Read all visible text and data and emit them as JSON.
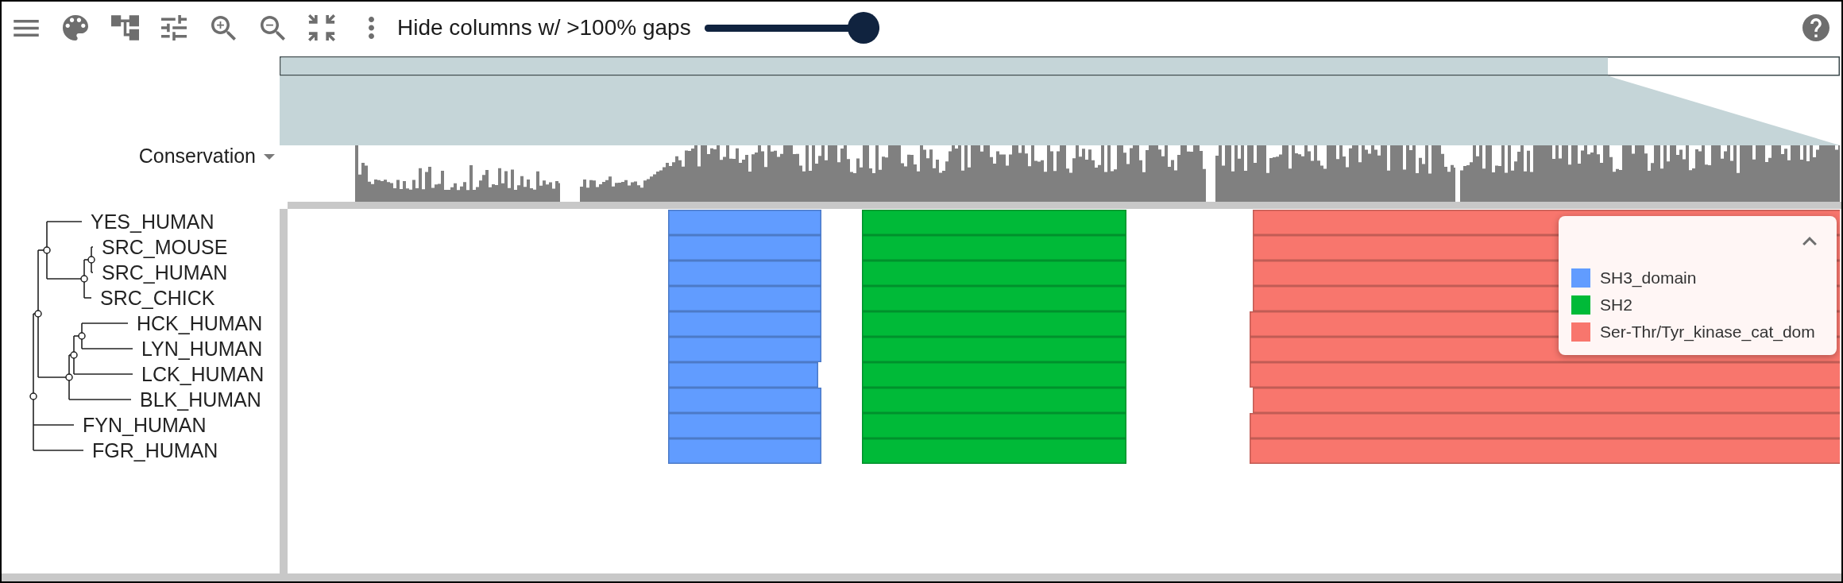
{
  "toolbar": {
    "gap_filter": {
      "label": "Hide columns w/ >100% gaps",
      "level": 1
    }
  },
  "conservation_track": {
    "label": "Conservation"
  },
  "tree": {
    "children": [
      {
        "children": [
          {
            "children": [
              {
                "label": "YES_HUMAN"
              },
              {
                "children": [
                  {
                    "children": [
                      {
                        "label": "SRC_MOUSE"
                      },
                      {
                        "label": "SRC_HUMAN"
                      }
                    ]
                  },
                  {
                    "label": "SRC_CHICK"
                  }
                ]
              }
            ]
          },
          {
            "children": [
              {
                "children": [
                  {
                    "children": [
                      {
                        "label": "HCK_HUMAN"
                      },
                      {
                        "label": "LYN_HUMAN"
                      }
                    ]
                  },
                  {
                    "label": "LCK_HUMAN"
                  }
                ]
              },
              {
                "label": "BLK_HUMAN"
              }
            ]
          }
        ]
      },
      {
        "label": "FYN_HUMAN"
      },
      {
        "label": "FGR_HUMAN"
      }
    ]
  },
  "legend": {
    "expanded": true,
    "items": [
      {
        "label": "SH3_domain",
        "color": "#619cff"
      },
      {
        "label": "SH2",
        "color": "#00ba38"
      },
      {
        "label": "Ser-Thr/Tyr_kinase_cat_dom",
        "color": "#f8766d"
      }
    ]
  }
}
